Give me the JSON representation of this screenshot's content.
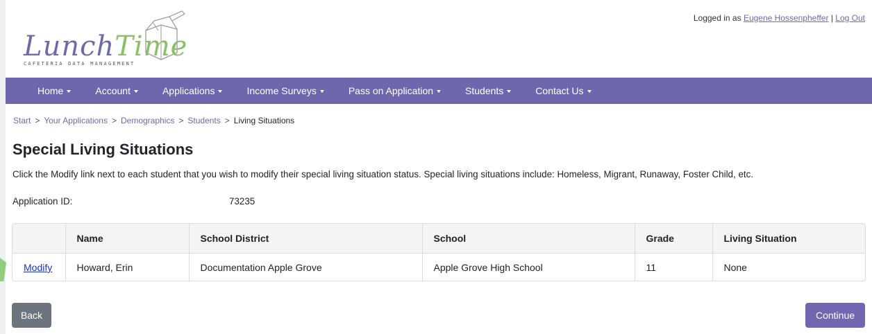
{
  "logo": {
    "name_part1": "Lunch",
    "name_part2": "Time",
    "tagline": "CAFETERIA DATA MANAGEMENT"
  },
  "login": {
    "prefix": "Logged in as",
    "user": "Eugene Hossenpheffer",
    "separator": "|",
    "logout": "Log Out"
  },
  "nav": {
    "items": [
      {
        "label": "Home"
      },
      {
        "label": "Account"
      },
      {
        "label": "Applications"
      },
      {
        "label": "Income Surveys"
      },
      {
        "label": "Pass on Application"
      },
      {
        "label": "Students"
      },
      {
        "label": "Contact Us"
      }
    ]
  },
  "breadcrumb": {
    "items": [
      "Start",
      "Your Applications",
      "Demographics",
      "Students",
      "Living Situations"
    ],
    "separator": ">"
  },
  "page": {
    "title": "Special Living Situations",
    "instructions": "Click the Modify link next to each student that you wish to modify their special living situation status. Special living situations include: Homeless, Migrant, Runaway, Foster Child, etc.",
    "app_id_label": "Application ID:",
    "app_id_value": "73235"
  },
  "table": {
    "headers": [
      "",
      "Name",
      "School District",
      "School",
      "Grade",
      "Living Situation"
    ],
    "rows": [
      {
        "action": "Modify",
        "name": "Howard, Erin",
        "district": "Documentation Apple Grove",
        "school": "Apple Grove High School",
        "grade": "11",
        "living": "None"
      }
    ]
  },
  "buttons": {
    "back": "Back",
    "continue": "Continue"
  },
  "colors": {
    "nav_bg": "#6f67ad",
    "link": "#6d6aa8",
    "back_btn": "#6c757d",
    "continue_btn": "#7067b0"
  }
}
